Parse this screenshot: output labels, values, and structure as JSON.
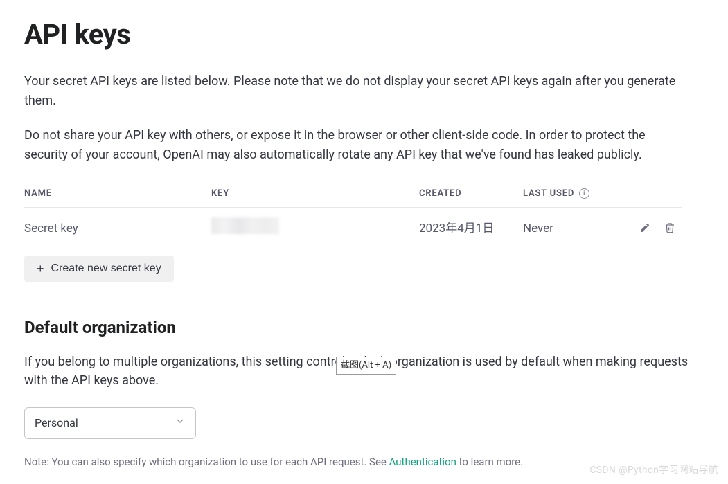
{
  "page": {
    "title": "API keys",
    "intro1": "Your secret API keys are listed below. Please note that we do not display your secret API keys again after you generate them.",
    "intro2": "Do not share your API key with others, or expose it in the browser or other client-side code. In order to protect the security of your account, OpenAI may also automatically rotate any API key that we've found has leaked publicly."
  },
  "table": {
    "headers": {
      "name": "NAME",
      "key": "KEY",
      "created": "CREATED",
      "last_used": "LAST USED"
    },
    "rows": [
      {
        "name": "Secret key",
        "key_masked": "",
        "created": "2023年4月1日",
        "last_used": "Never"
      }
    ]
  },
  "actions": {
    "create_label": "Create new secret key"
  },
  "org": {
    "heading": "Default organization",
    "description": "If you belong to multiple organizations, this setting controls which organization is used by default when making requests with the API keys above.",
    "tooltip": "截图(Alt + A)",
    "selected": "Personal",
    "note_prefix": "Note: You can also specify which organization to use for each API request. See ",
    "note_link_text": "Authentication",
    "note_suffix": " to learn more."
  },
  "watermark": "CSDN @Python学习网站导航"
}
